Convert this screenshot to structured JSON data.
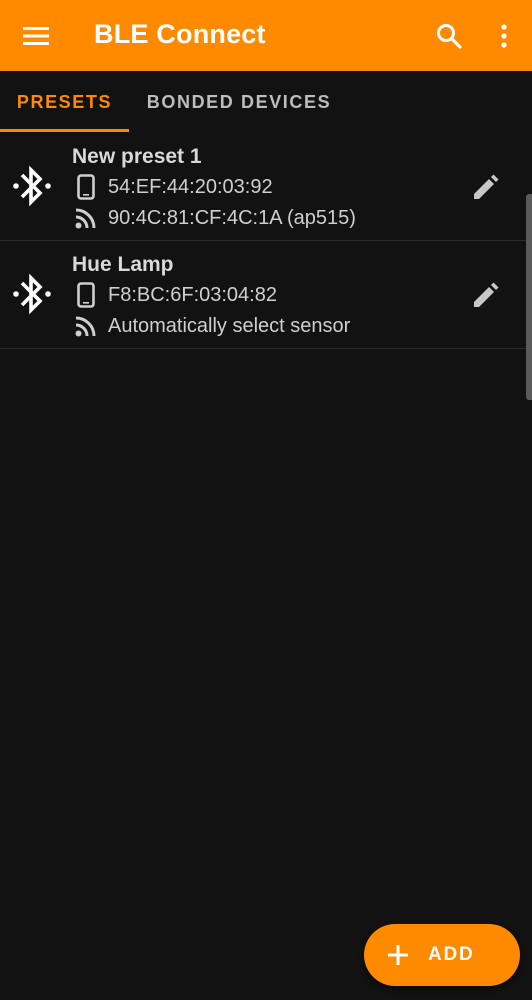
{
  "app": {
    "title": "BLE Connect",
    "accent_color": "#FF8A00",
    "background_color": "#121212"
  },
  "toolbar": {
    "icons": [
      "menu-icon",
      "search-icon",
      "more-vert-icon"
    ]
  },
  "tabs": [
    {
      "label": "PRESETS",
      "selected": true
    },
    {
      "label": "BONDED DEVICES",
      "selected": false
    }
  ],
  "presets": [
    {
      "name": "New preset 1",
      "device_address": "54:EF:44:20:03:92",
      "sensor": "90:4C:81:CF:4C:1A (ap515)"
    },
    {
      "name": "Hue Lamp",
      "device_address": "F8:BC:6F:03:04:82",
      "sensor": "Automatically select sensor"
    }
  ],
  "fab": {
    "label": "ADD",
    "icon": "plus-icon"
  }
}
